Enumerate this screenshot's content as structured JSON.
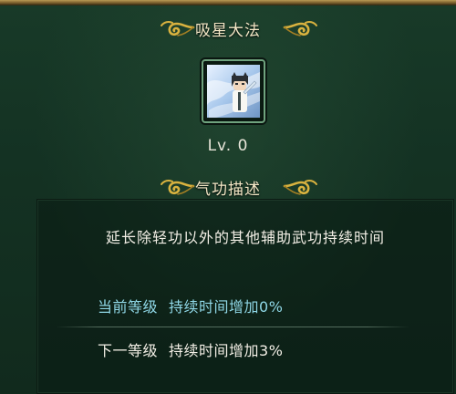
{
  "skill": {
    "name": "吸星大法",
    "icon": "swordsman-portrait-icon",
    "level": "Lv. 0"
  },
  "description": {
    "header": "气功描述",
    "text": "延长除轻功以外的其他辅助武功持续时间"
  },
  "levels": {
    "current": {
      "label": "当前等级",
      "effect": "持续时间增加0%"
    },
    "next": {
      "label": "下一等级",
      "effect": "持续时间增加3%"
    }
  },
  "colors": {
    "background": "#143223",
    "ornament_gold": "#d9b23f",
    "current_level_text": "#8fd7e6",
    "title_text": "#f4e7c6"
  }
}
